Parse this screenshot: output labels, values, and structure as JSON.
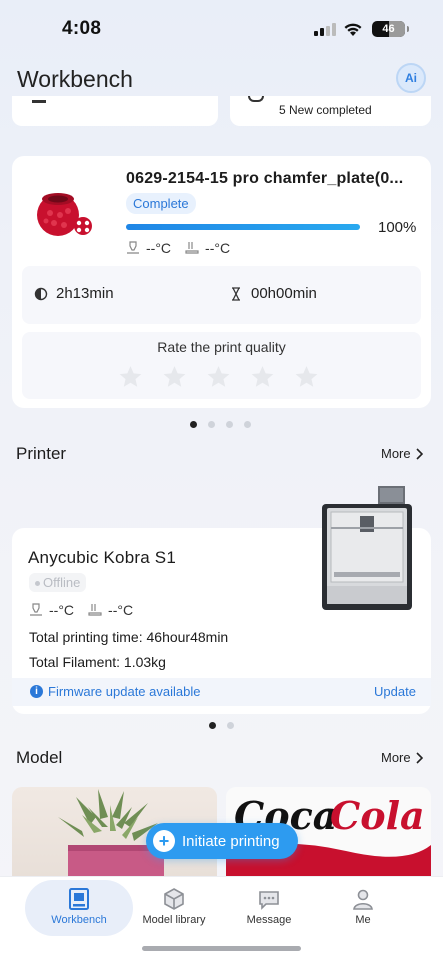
{
  "status_bar": {
    "time": "4:08",
    "battery": "46"
  },
  "header": {
    "title": "Workbench",
    "ai_label": "Ai"
  },
  "peek_cards": {
    "right_text": "5  New completed"
  },
  "print_job": {
    "name": "0629-2154-15 pro chamfer_plate(0...",
    "status": "Complete",
    "progress_percent": 100,
    "progress_label": "100%",
    "nozzle_temp": "--°C",
    "bed_temp": "--°C",
    "elapsed": "2h13min",
    "remaining": "00h00min",
    "rate_label": "Rate the print quality",
    "stars_total": 5,
    "stars_filled": 0
  },
  "job_carousel": {
    "pages": 4,
    "active": 0
  },
  "printer_section": {
    "title": "Printer",
    "more": "More",
    "name": "Anycubic Kobra S1",
    "state": "Offline",
    "nozzle_temp": "--°C",
    "bed_temp": "--°C",
    "total_time": "Total printing time: 46hour48min",
    "total_filament": "Total Filament: 1.03kg",
    "firmware_text": "Firmware update available",
    "update_label": "Update"
  },
  "printer_carousel": {
    "pages": 2,
    "active": 0
  },
  "model_section": {
    "title": "Model",
    "more": "More"
  },
  "fab": {
    "label": "Initiate printing"
  },
  "tabs": [
    {
      "label": "Workbench",
      "icon": "workbench-icon",
      "active": true
    },
    {
      "label": "Model library",
      "icon": "model-library-icon",
      "active": false
    },
    {
      "label": "Message",
      "icon": "message-icon",
      "active": false
    },
    {
      "label": "Me",
      "icon": "person-icon",
      "active": false
    }
  ],
  "colors": {
    "accent": "#2b78d8",
    "fab": "#2d9bf0",
    "model_red": "#c8102e"
  }
}
